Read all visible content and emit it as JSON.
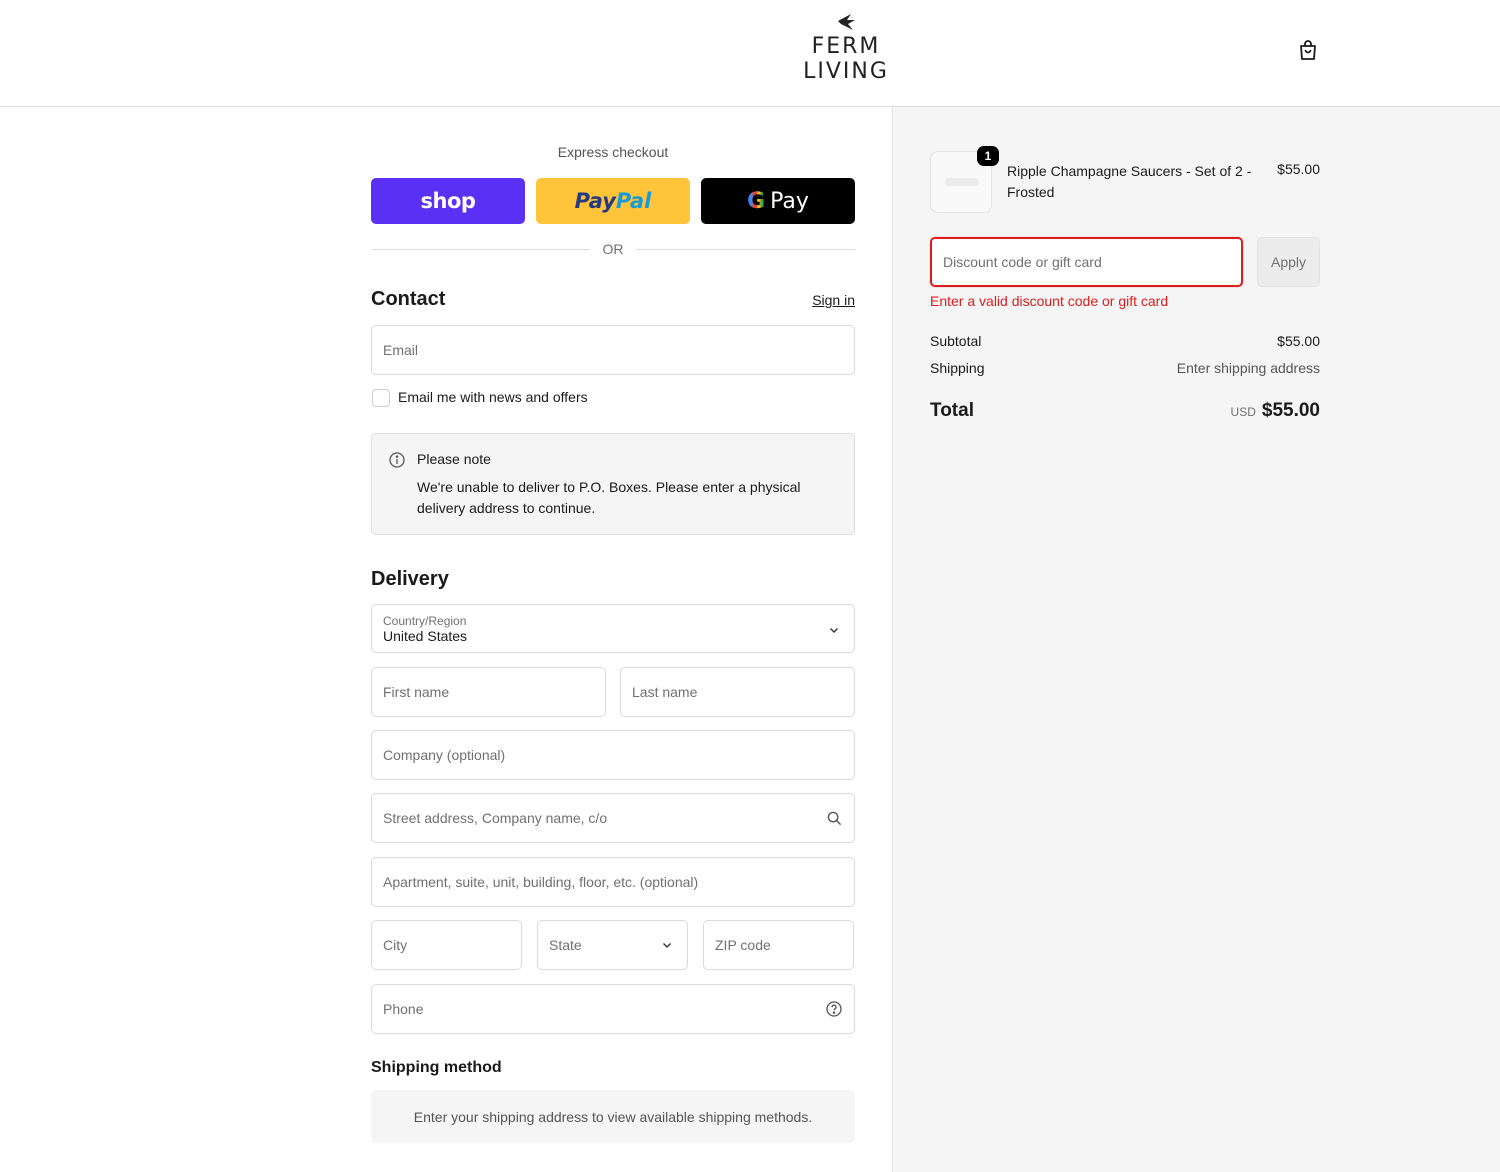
{
  "header": {
    "logo_line1": "FERM",
    "logo_line2": "LIVING"
  },
  "express": {
    "title": "Express checkout",
    "shop_label": "shop",
    "paypal_label_1": "Pay",
    "paypal_label_2": "Pal",
    "gpay_g": "G",
    "gpay_label": "Pay",
    "or_label": "OR"
  },
  "contact": {
    "title": "Contact",
    "signin_label": "Sign in",
    "email_placeholder": "Email",
    "newsletter_label": "Email me with news and offers"
  },
  "note": {
    "title": "Please note",
    "body": "We're unable to deliver to P.O. Boxes. Please enter a physical delivery address to continue."
  },
  "delivery": {
    "title": "Delivery",
    "country_label": "Country/Region",
    "country_value": "United States",
    "first_name": "First name",
    "last_name": "Last name",
    "company": "Company (optional)",
    "street": "Street address, Company name, c/o",
    "apartment": "Apartment, suite, unit, building, floor, etc. (optional)",
    "city": "City",
    "state": "State",
    "zip": "ZIP code",
    "phone": "Phone"
  },
  "shipping_method": {
    "title": "Shipping method",
    "message": "Enter your shipping address to view available shipping methods."
  },
  "summary": {
    "item": {
      "quantity": "1",
      "name": "Ripple Champagne Saucers - Set of 2 - Frosted",
      "price": "$55.00"
    },
    "discount_placeholder": "Discount code or gift card",
    "apply_label": "Apply",
    "discount_error": "Enter a valid discount code or gift card",
    "subtotal_label": "Subtotal",
    "subtotal_value": "$55.00",
    "shipping_label": "Shipping",
    "shipping_value": "Enter shipping address",
    "total_label": "Total",
    "total_currency": "USD",
    "total_value": "$55.00"
  },
  "colors": {
    "shop_purple": "#5a31f4",
    "paypal_yellow": "#ffc439",
    "error_red": "#dd1d1d",
    "summary_bg": "#f5f5f5"
  },
  "icons": [
    "bird-logo-icon",
    "shopping-bag-icon",
    "info-icon",
    "chevron-down-icon",
    "search-icon",
    "help-circle-icon"
  ]
}
